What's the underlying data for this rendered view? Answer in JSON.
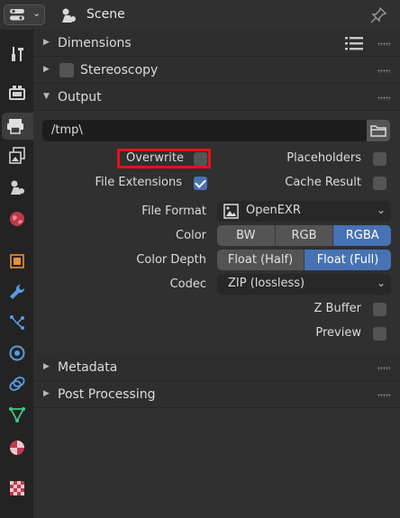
{
  "header": {
    "scene_label": "Scene"
  },
  "tabs": [
    {
      "name": "tool-tab",
      "icon": "tool-icon"
    },
    {
      "name": "render-tab",
      "icon": "render-icon"
    },
    {
      "name": "output-tab",
      "icon": "output-icon",
      "active": true
    },
    {
      "name": "view-layer-tab",
      "icon": "view-layer-icon"
    },
    {
      "name": "scene-tab",
      "icon": "scene-icon"
    },
    {
      "name": "world-tab",
      "icon": "world-icon"
    },
    {
      "name": "object-tab",
      "icon": "object-icon"
    },
    {
      "name": "modifiers-tab",
      "icon": "wrench-icon"
    },
    {
      "name": "particles-tab",
      "icon": "particles-icon"
    },
    {
      "name": "physics-tab",
      "icon": "physics-icon"
    },
    {
      "name": "constraints-tab",
      "icon": "constraints-icon"
    },
    {
      "name": "data-tab",
      "icon": "mesh-data-icon"
    },
    {
      "name": "material-tab",
      "icon": "material-icon"
    },
    {
      "name": "texture-tab",
      "icon": "texture-icon"
    }
  ],
  "panels": {
    "dimensions": "Dimensions",
    "stereoscopy": "Stereoscopy",
    "output": "Output",
    "metadata": "Metadata",
    "post_processing": "Post Processing"
  },
  "output": {
    "path": "/tmp\\",
    "overwrite_label": "Overwrite",
    "overwrite_checked": false,
    "placeholders_label": "Placeholders",
    "placeholders_checked": false,
    "file_extensions_label": "File Extensions",
    "file_extensions_checked": true,
    "cache_result_label": "Cache Result",
    "cache_result_checked": false,
    "file_format_label": "File Format",
    "file_format_value": "OpenEXR",
    "color_label": "Color",
    "color_options": [
      "BW",
      "RGB",
      "RGBA"
    ],
    "color_selected": "RGBA",
    "color_depth_label": "Color Depth",
    "color_depth_options": [
      "Float (Half)",
      "Float (Full)"
    ],
    "color_depth_selected": "Float (Full)",
    "codec_label": "Codec",
    "codec_value": "ZIP (lossless)",
    "z_buffer_label": "Z Buffer",
    "z_buffer_checked": false,
    "preview_label": "Preview",
    "preview_checked": false
  },
  "colors": {
    "accent": "#4772b3",
    "highlight": "#e8101a"
  }
}
